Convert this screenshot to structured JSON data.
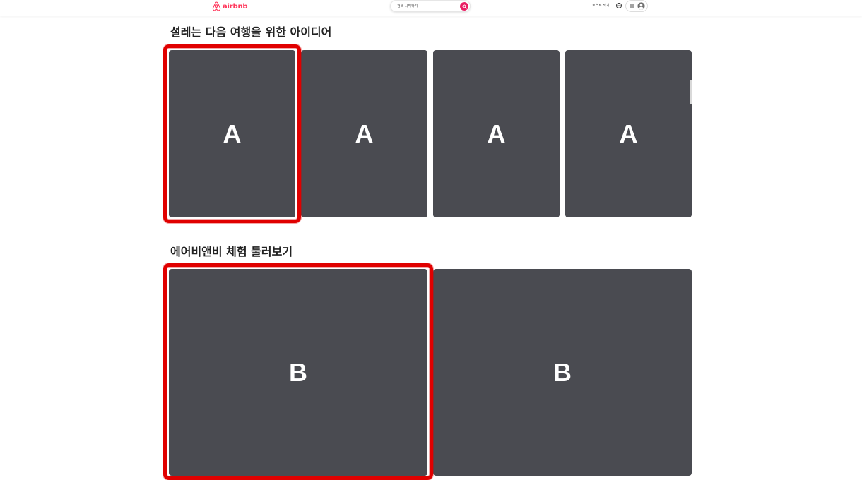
{
  "header": {
    "logo_text": "airbnb",
    "search_placeholder": "검색 시작하기",
    "host_link": "호스트 되기",
    "icons": [
      "airbnb-logo-icon",
      "search-icon",
      "globe-icon",
      "menu-icon",
      "avatar-icon"
    ]
  },
  "sections": [
    {
      "title": "설레는 다음 여행을 위한 아이디어",
      "cards": [
        {
          "label": "A"
        },
        {
          "label": "A"
        },
        {
          "label": "A"
        },
        {
          "label": "A"
        }
      ]
    },
    {
      "title": "에어비앤비 체험 둘러보기",
      "cards": [
        {
          "label": "B"
        },
        {
          "label": "B"
        }
      ]
    }
  ],
  "colors": {
    "brand": "#ff385c",
    "card_fill": "#4a4b51",
    "highlight": "#e00000",
    "search_button": "#e91e63"
  }
}
